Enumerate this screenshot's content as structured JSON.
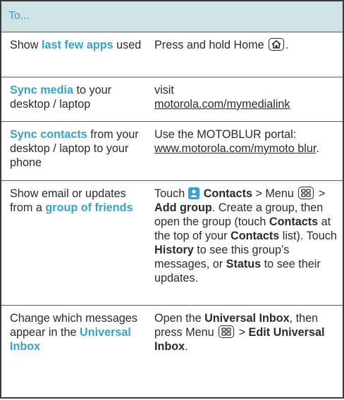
{
  "header": "To...",
  "rows": [
    {
      "left_a": "Show ",
      "left_hl": "last few apps",
      "left_b": " used",
      "right_a": "Press and hold Home",
      "right_b": "."
    },
    {
      "left_hl": "Sync media",
      "left_b": " to your desktop / laptop",
      "right_a": "visit",
      "right_link": "motorola.com/mymedialink"
    },
    {
      "left_hl": "Sync contacts",
      "left_b": " from your desktop / laptop to your phone",
      "right_a": "Use the MOTOBLUR portal:",
      "right_link": "www.motorola.com/mymoto blur",
      "right_b": "."
    },
    {
      "left_a": "Show email or updates from a ",
      "left_hl": "group of friends",
      "right_t1": "Touch ",
      "right_b1": "Contacts",
      "right_t2": " > Menu ",
      "right_t3": " > ",
      "right_b2": "Add group",
      "right_t4": ". Create a group, then open the group (touch ",
      "right_b3": "Contacts",
      "right_t5": " at the top of your ",
      "right_b4": "Contacts",
      "right_t6": " list). Touch ",
      "right_b5": "History",
      "right_t7": " to see this group’s messages, or ",
      "right_b6": "Status",
      "right_t8": " to see their updates."
    },
    {
      "left_a": "Change which messages appear in the ",
      "left_hl": "Universal Inbox",
      "right_t1": "Open the ",
      "right_b1": "Universal Inbox",
      "right_t2": ", then press Menu ",
      "right_t3": " > ",
      "right_b2": "Edit Universal Inbox",
      "right_t4": "."
    }
  ],
  "icons": {
    "home": "home-icon",
    "menu": "menu-icon",
    "contacts": "contacts-icon"
  },
  "colors": {
    "header_bg": "#cfe2e8",
    "accent": "#3aa0c8"
  }
}
